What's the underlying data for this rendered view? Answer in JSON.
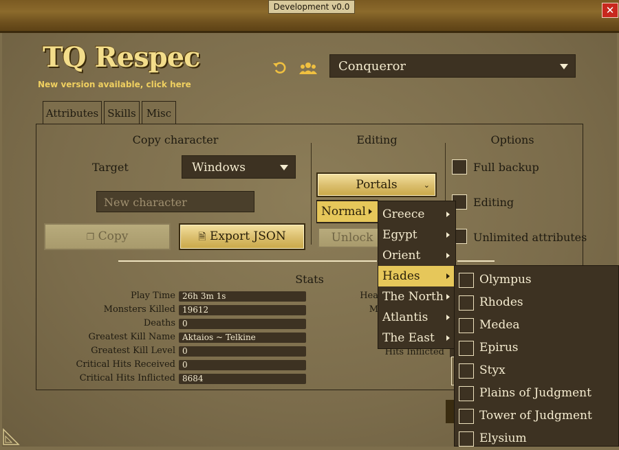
{
  "window": {
    "title": "Development v0.0",
    "close_label": "✕"
  },
  "header": {
    "app_title": "TQ Respec",
    "update_notice": "New version available, click here",
    "character_selected": "Conqueror"
  },
  "tabs": [
    {
      "label": "Attributes"
    },
    {
      "label": "Skills"
    },
    {
      "label": "Misc"
    }
  ],
  "copy_section": {
    "title": "Copy character",
    "target_label": "Target",
    "target_value": "Windows",
    "new_character_placeholder": "New character",
    "copy_button": "Copy",
    "export_button": "Export JSON"
  },
  "editing_section": {
    "title": "Editing",
    "portals_button": "Portals",
    "unlock_button": "Unlock"
  },
  "options_section": {
    "title": "Options",
    "full_backup": "Full backup",
    "editing": "Editing",
    "unlimited_attributes": "Unlimited attributes"
  },
  "stats": {
    "title": "Stats",
    "rows": [
      {
        "label": "Play Time",
        "value": "26h  3m  1s"
      },
      {
        "label": "Monsters Killed",
        "value": "19612"
      },
      {
        "label": "Deaths",
        "value": "0"
      },
      {
        "label": "Greatest Kill Name",
        "value": "Aktaios ~ Telkine"
      },
      {
        "label": "Greatest Kill Level",
        "value": "0"
      },
      {
        "label": "Critical Hits Received",
        "value": "0"
      },
      {
        "label": "Critical Hits Inflicted",
        "value": "8684"
      }
    ],
    "right_partial": [
      "Hea",
      "M",
      "Hits Inflicted"
    ]
  },
  "difficulty_menu": {
    "items": [
      {
        "label": "Normal"
      }
    ]
  },
  "region_menu": {
    "items": [
      {
        "label": "Greece"
      },
      {
        "label": "Egypt"
      },
      {
        "label": "Orient"
      },
      {
        "label": "Hades"
      },
      {
        "label": "The North"
      },
      {
        "label": "Atlantis"
      },
      {
        "label": "The East"
      }
    ]
  },
  "hades_menu": {
    "items": [
      {
        "label": "Olympus"
      },
      {
        "label": "Rhodes"
      },
      {
        "label": "Medea"
      },
      {
        "label": "Epirus"
      },
      {
        "label": "Styx"
      },
      {
        "label": "Plains of Judgment"
      },
      {
        "label": "Tower of Judgment"
      },
      {
        "label": "Elysium"
      }
    ]
  },
  "colors": {
    "accent_gold": "#e6c75a",
    "dark_field": "#3d3222",
    "close_red": "#c8281e"
  }
}
